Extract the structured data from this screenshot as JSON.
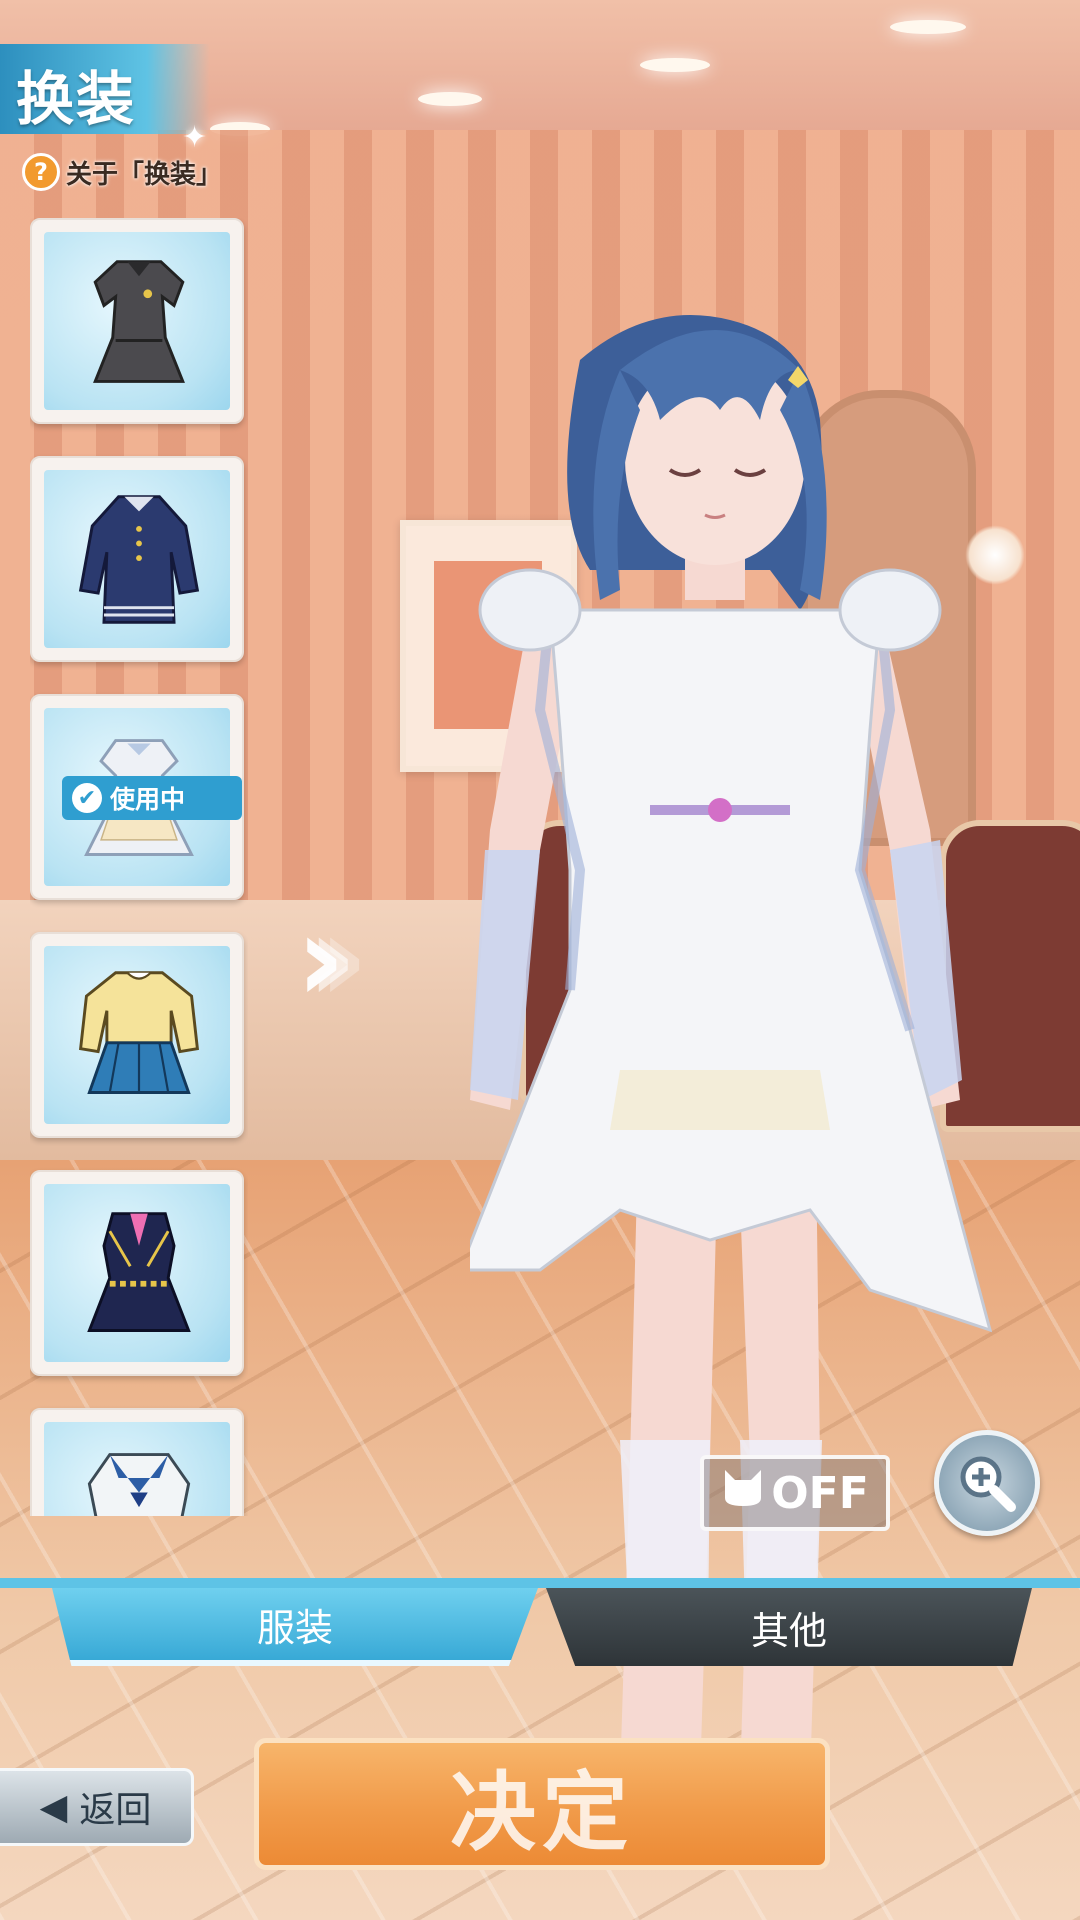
{
  "header": {
    "title": "换装",
    "about_label": "关于「换装」",
    "about_icon": "?"
  },
  "outfits": [
    {
      "name": "gray-uniform"
    },
    {
      "name": "navy-coat"
    },
    {
      "name": "white-dress",
      "in_use": true
    },
    {
      "name": "yellow-sweater-blue-skirt"
    },
    {
      "name": "idol-costume"
    },
    {
      "name": "sailor-uniform"
    }
  ],
  "in_use_label": "使用中",
  "cat_toggle": {
    "icon": "cat-icon",
    "label": "OFF"
  },
  "zoom": {
    "icon": "zoom-in-icon"
  },
  "tabs": [
    {
      "label": "服装",
      "active": true
    },
    {
      "label": "其他",
      "active": false
    }
  ],
  "back_label": "返回",
  "confirm_label": "决定",
  "colors": {
    "accent": "#3ba9d6",
    "confirm": "#f19b4a",
    "tab_inactive": "#3a4246"
  }
}
